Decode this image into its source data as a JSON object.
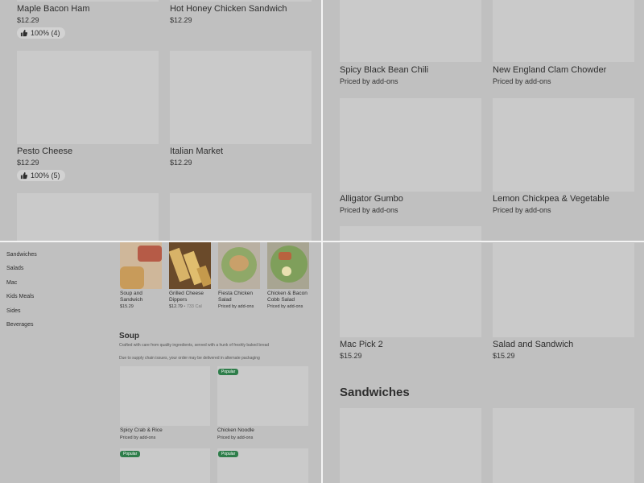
{
  "top_left": {
    "items": [
      {
        "name": "Maple Bacon Ham",
        "price": "$12.29",
        "rating": "100% (4)"
      },
      {
        "name": "Hot Honey Chicken Sandwich",
        "price": "$12.29"
      },
      {
        "name": "Pesto Cheese",
        "price": "$12.29",
        "rating": "100% (5)"
      },
      {
        "name": "Italian Market",
        "price": "$12.29"
      }
    ]
  },
  "top_right": {
    "items": [
      {
        "name": "Spicy Black Bean Chili",
        "price": "Priced by add-ons"
      },
      {
        "name": "New England Clam Chowder",
        "price": "Priced by add-ons"
      },
      {
        "name": "Alligator Gumbo",
        "price": "Priced by add-ons"
      },
      {
        "name": "Lemon Chickpea & Vegetable",
        "price": "Priced by add-ons"
      }
    ]
  },
  "bottom_left": {
    "sidebar": [
      "Sandwiches",
      "Salads",
      "Mac",
      "Kids Meals",
      "Sides",
      "Beverages"
    ],
    "featured": [
      {
        "name": "Soup and Sandwich",
        "price": "$15.29"
      },
      {
        "name": "Grilled Cheese Dippers",
        "price": "$12.79",
        "calories": "• 733 Cal"
      },
      {
        "name": "Fiesta Chicken Salad",
        "price": "Priced by add-ons"
      },
      {
        "name": "Chicken & Bacon Cobb Salad",
        "price": "Priced by add-ons"
      }
    ],
    "section_title": "Soup",
    "section_desc": "Crafted with care from quality ingredients, served with a hunk of freshly baked bread",
    "notice": "Due to supply chain issues, your order may be delivered in alternate packaging",
    "popular_label": "Popular",
    "soup_items": [
      {
        "name": "Spicy Crab & Rice",
        "price": "Priced by add-ons"
      },
      {
        "name": "Chicken Noodle",
        "price": "Priced by add-ons"
      }
    ]
  },
  "bottom_right": {
    "items": [
      {
        "name": "Mac Pick 2",
        "price": "$15.29"
      },
      {
        "name": "Salad and Sandwich",
        "price": "$15.29"
      }
    ],
    "section_title": "Sandwiches"
  },
  "colors": {
    "overlay": "#bdbdbd",
    "placeholder": "#cacaca",
    "popular": "#2e7d4a"
  }
}
